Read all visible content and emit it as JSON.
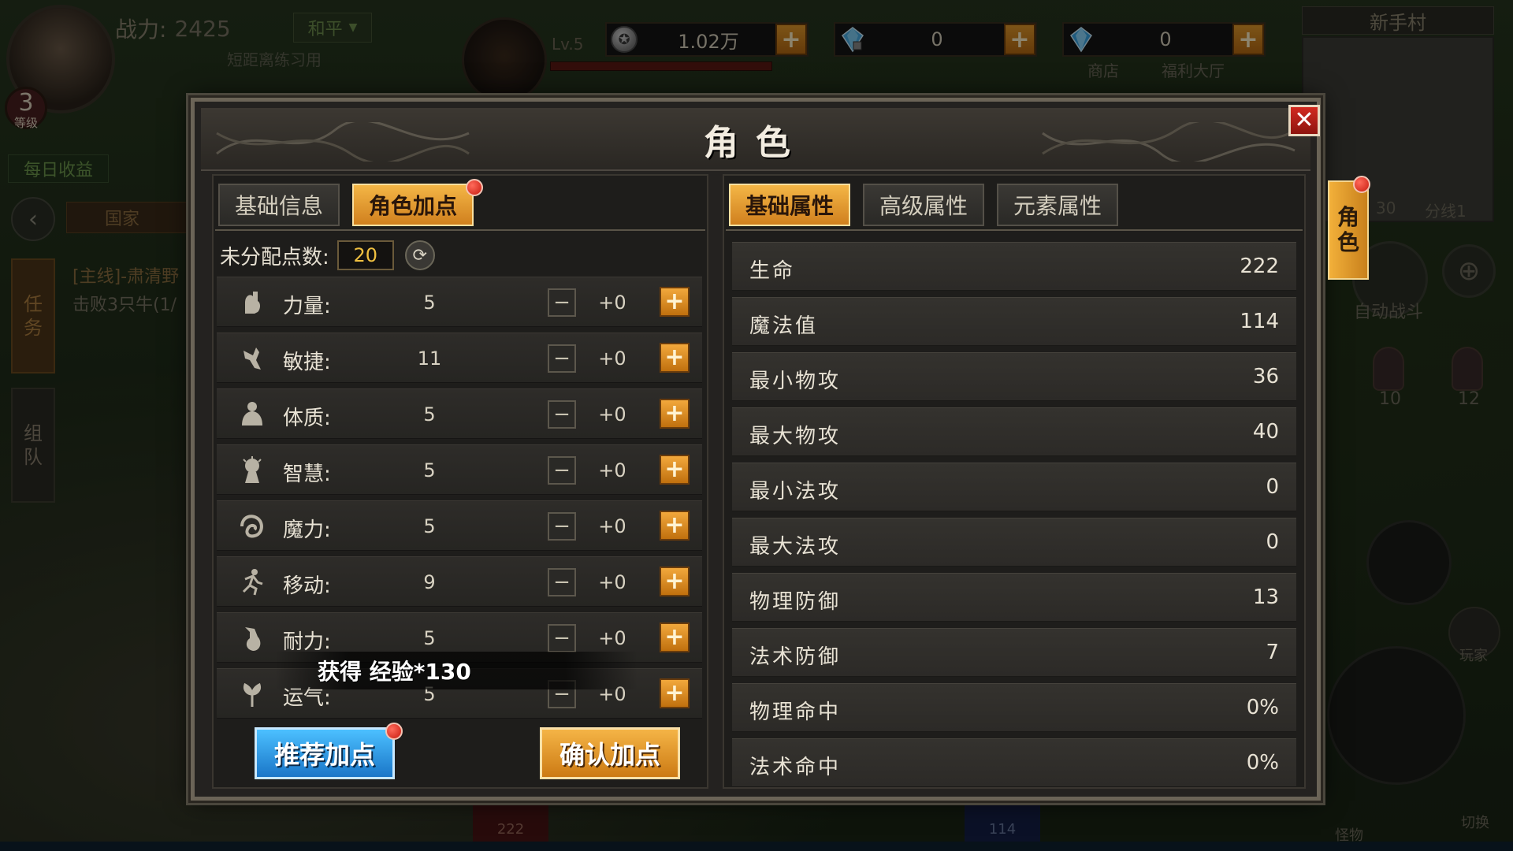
{
  "hud": {
    "power_label": "战力:",
    "power_value": "2425",
    "pk_mode": "和平",
    "sub_text": "短距离练习用",
    "level_num": "3",
    "level_label": "等级",
    "daily": "每日收益",
    "nation": "国家",
    "side_task": "任务",
    "side_team": "组队",
    "quest_line1": "[主线]-肃清野",
    "quest_line2": "击败3只牛(1/",
    "mount_level": "Lv.5",
    "silver_value": "1.02万",
    "diamond_locked_value": "0",
    "diamond_value": "0",
    "shop_label": "商店",
    "welfare_label": "福利大厅",
    "map_name": "新手村",
    "map_coord": "30",
    "map_line": "分线1",
    "auto_battle": "自动战斗",
    "potion_hp_count": "10",
    "potion_mp_count": "12",
    "player_label": "玩家",
    "switch_label": "切换",
    "monster_label": "怪物",
    "hp_bottom": "222",
    "mp_bottom": "114"
  },
  "dialog": {
    "title": "角色",
    "close_symbol": "✕",
    "side_tab": "角色",
    "left_tabs": [
      {
        "label": "基础信息",
        "active": false
      },
      {
        "label": "角色加点",
        "active": true
      }
    ],
    "unallocated_label": "未分配点数:",
    "unallocated_value": "20",
    "stats": [
      {
        "label": "力量:",
        "value": "5",
        "add": "+0",
        "icon": "strength-icon"
      },
      {
        "label": "敏捷:",
        "value": "11",
        "add": "+0",
        "icon": "agility-icon"
      },
      {
        "label": "体质:",
        "value": "5",
        "add": "+0",
        "icon": "constitution-icon"
      },
      {
        "label": "智慧:",
        "value": "5",
        "add": "+0",
        "icon": "wisdom-icon"
      },
      {
        "label": "魔力:",
        "value": "5",
        "add": "+0",
        "icon": "magic-icon"
      },
      {
        "label": "移动:",
        "value": "9",
        "add": "+0",
        "icon": "movement-icon"
      },
      {
        "label": "耐力:",
        "value": "5",
        "add": "+0",
        "icon": "stamina-icon"
      },
      {
        "label": "运气:",
        "value": "5",
        "add": "+0",
        "icon": "luck-icon"
      }
    ],
    "exp_popup": "获得 经验*130",
    "btn_recommend": "推荐加点",
    "btn_confirm": "确认加点",
    "right_tabs": [
      {
        "label": "基础属性",
        "active": true
      },
      {
        "label": "高级属性",
        "active": false
      },
      {
        "label": "元素属性",
        "active": false
      }
    ],
    "attributes": [
      {
        "name": "生命",
        "value": "222"
      },
      {
        "name": "魔法值",
        "value": "114"
      },
      {
        "name": "最小物攻",
        "value": "36"
      },
      {
        "name": "最大物攻",
        "value": "40"
      },
      {
        "name": "最小法攻",
        "value": "0"
      },
      {
        "name": "最大法攻",
        "value": "0"
      },
      {
        "name": "物理防御",
        "value": "13"
      },
      {
        "name": "法术防御",
        "value": "7"
      },
      {
        "name": "物理命中",
        "value": "0%"
      },
      {
        "name": "法术命中",
        "value": "0%"
      }
    ]
  },
  "colors": {
    "accent_orange": "#f4b646",
    "accent_blue": "#4cc0ff",
    "close_red": "#d22a20",
    "unallocated_yellow": "#f0c040"
  }
}
